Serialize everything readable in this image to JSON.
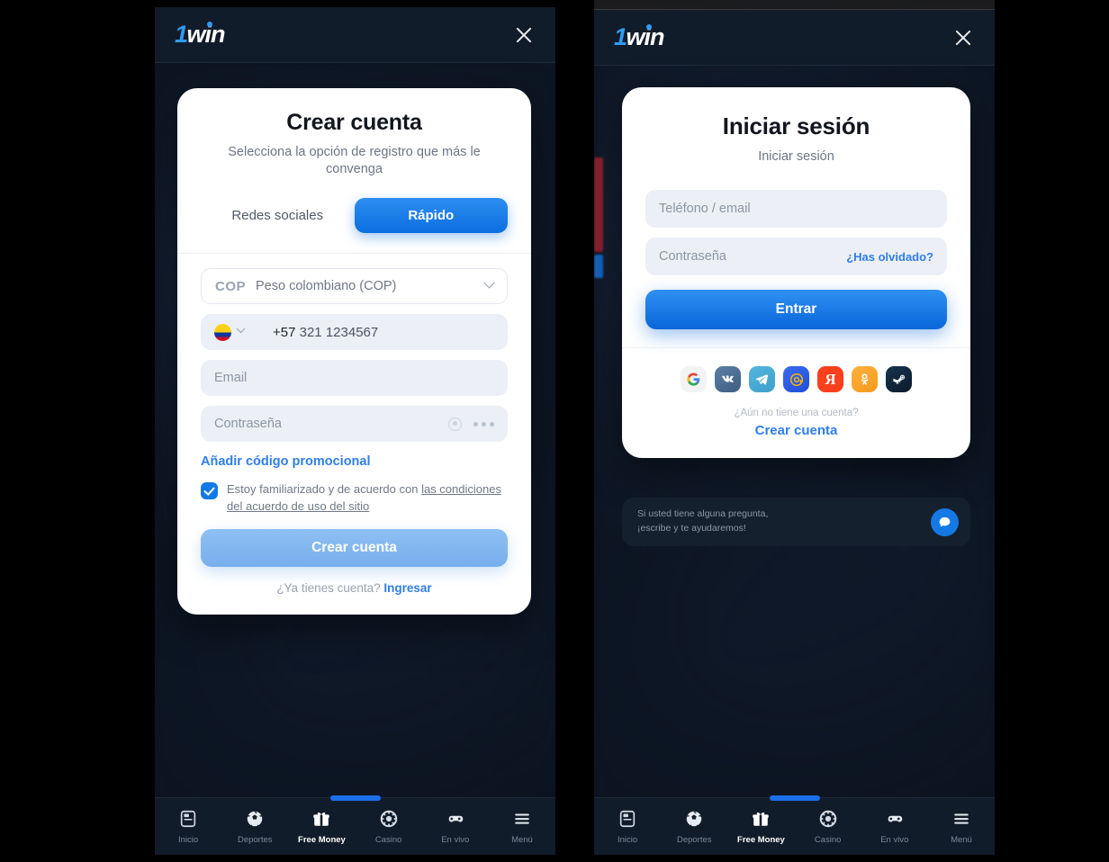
{
  "meta": {
    "brand_blue": "#2f9bf5",
    "accent": "#1479e4",
    "panel_bg": "#0e1826",
    "card_bg": "#ffffff"
  },
  "logo": {
    "part1": "1",
    "part2": "win"
  },
  "register_panel": {
    "close_label": "×",
    "card": {
      "title": "Crear cuenta",
      "subtitle": "Selecciona la opción de registro que más le convenga",
      "tabs": [
        {
          "label": "Redes sociales",
          "active": false
        },
        {
          "label": "Rápido",
          "active": true
        }
      ],
      "currency": {
        "code": "COP",
        "name": "Peso colombiano (COP)"
      },
      "phone": {
        "flag": "colombia-flag-icon",
        "country_code": "+57",
        "placeholder": "321 1234567"
      },
      "email_placeholder": "Email",
      "password_placeholder": "Contraseña",
      "promo_link": "Añadir código promocional",
      "terms_prefix": "Estoy familiarizado y de acuerdo con ",
      "terms_link": "las condiciones del acuerdo de uso del sitio",
      "terms_checked": true,
      "submit_label": "Crear cuenta",
      "footer_text": "¿Ya tienes cuenta? ",
      "footer_link": "Ingresar"
    }
  },
  "login_panel": {
    "close_label": "×",
    "card": {
      "title": "Iniciar sesión",
      "subtitle": "Iniciar sesión",
      "identifier_placeholder": "Teléfono / email",
      "password_placeholder": "Contraseña",
      "forgot_label": "¿Has olvidado?",
      "submit_label": "Entrar",
      "socials": [
        {
          "name": "google",
          "label": "G"
        },
        {
          "name": "vk",
          "label": "VK"
        },
        {
          "name": "telegram",
          "label": "TG"
        },
        {
          "name": "mailru",
          "label": "@"
        },
        {
          "name": "yandex",
          "label": "Я"
        },
        {
          "name": "odnoklassniki",
          "label": "OK"
        },
        {
          "name": "steam",
          "label": "S"
        }
      ],
      "footer_text": "¿Aún no tiene una cuenta?",
      "footer_link": "Crear cuenta"
    },
    "chat": {
      "line1": "Si usted tiene alguna pregunta,",
      "line2": "¡escribe y te ayudaremos!"
    }
  },
  "bottom_nav": [
    {
      "label": "Inicio",
      "icon": "home-icon",
      "active": false
    },
    {
      "label": "Deportes",
      "icon": "soccer-icon",
      "active": false
    },
    {
      "label": "Free Money",
      "icon": "gift-icon",
      "active": true
    },
    {
      "label": "Casino",
      "icon": "chip-icon",
      "active": false
    },
    {
      "label": "En vivo",
      "icon": "gamepad-icon",
      "active": false
    },
    {
      "label": "Menú",
      "icon": "hamburger-icon",
      "active": false
    }
  ]
}
